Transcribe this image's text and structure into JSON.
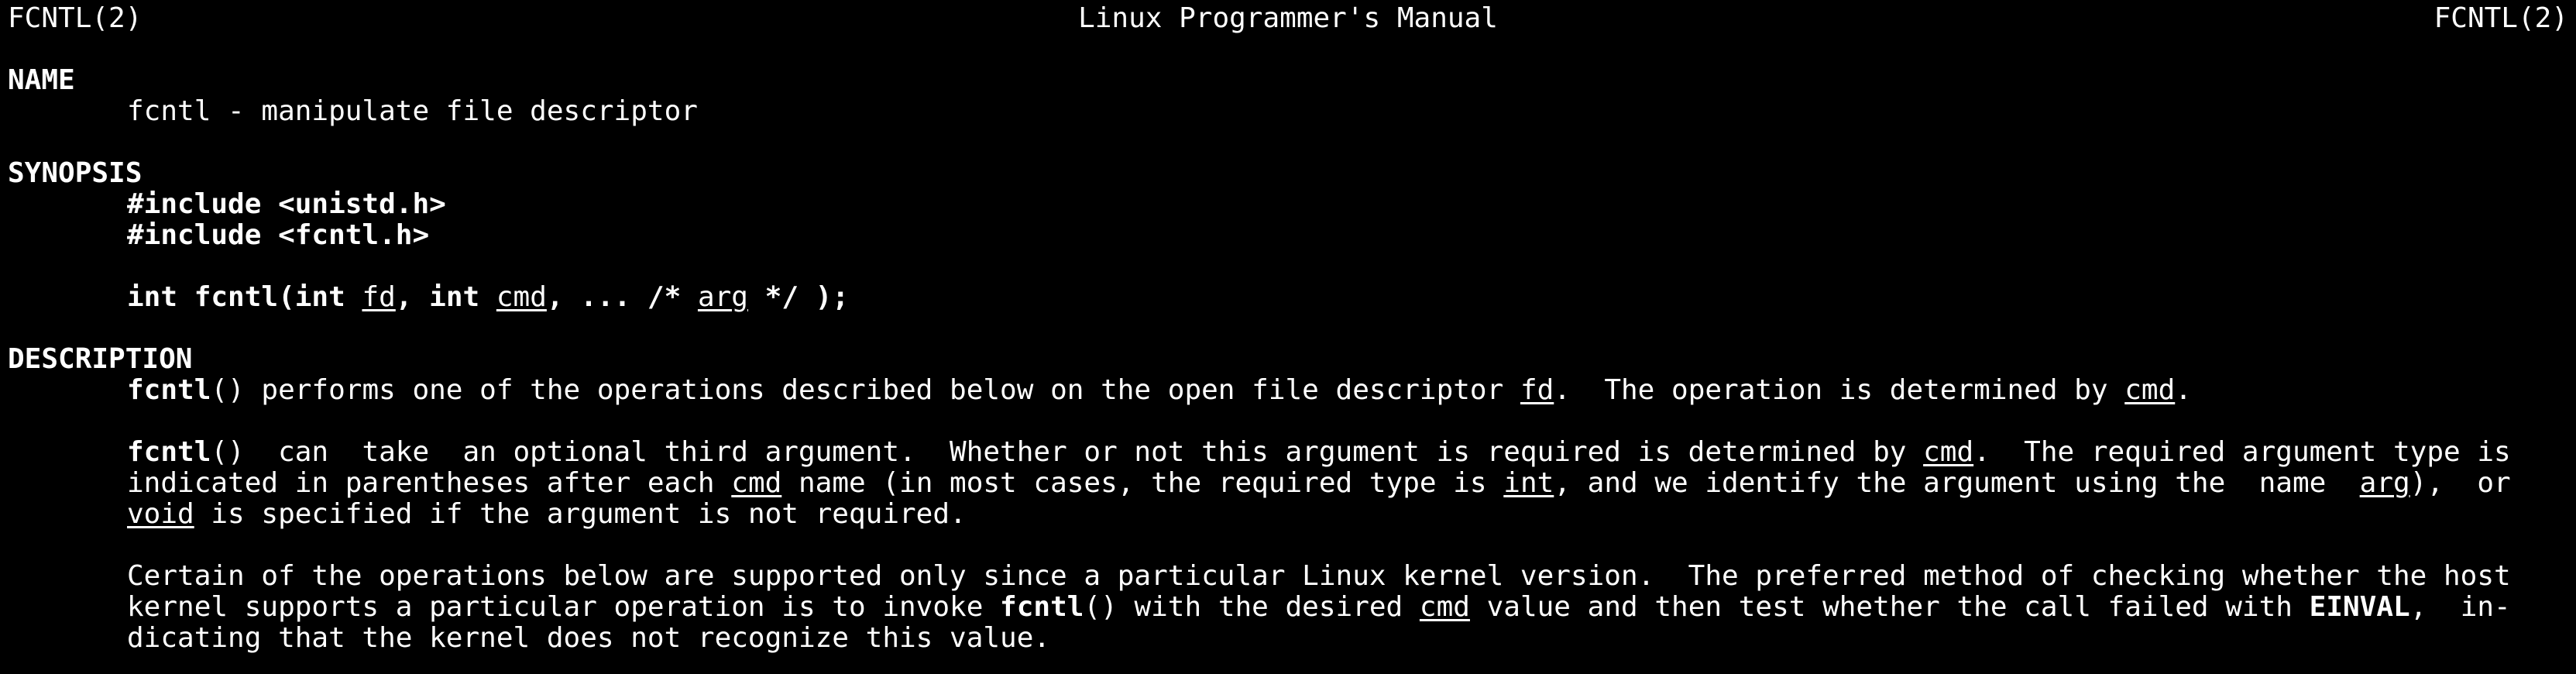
{
  "header": {
    "left": "FCNTL(2)",
    "center": "Linux Programmer's Manual",
    "right": "FCNTL(2)"
  },
  "sections": {
    "name": {
      "title": "NAME",
      "text": "fcntl - manipulate file descriptor"
    },
    "synopsis": {
      "title": "SYNOPSIS",
      "include1": "#include <unistd.h>",
      "include2": "#include <fcntl.h>",
      "proto": {
        "p1": "int fcntl(int ",
        "fd": "fd",
        "p2": ", int ",
        "cmd": "cmd",
        "p3": ", ... /* ",
        "arg": "arg",
        "p4": " */ );"
      }
    },
    "description": {
      "title": "DESCRIPTION",
      "para1": {
        "fn": "fcntl",
        "t1": "() performs one of the operations described below on the open file descriptor ",
        "fd": "fd",
        "t2": ".  The operation is determined by ",
        "cmd": "cmd",
        "t3": "."
      },
      "para2": {
        "l1_fn": "fcntl",
        "l1_t1": "()  can  take  an optional third argument.  Whether or not this argument is required is determined by ",
        "l1_cmd": "cmd",
        "l1_t2": ".  The required argument type is",
        "l2_t1": "indicated in parentheses after each ",
        "l2_cmd": "cmd",
        "l2_t2": " name (in most cases, the required type is ",
        "l2_int": "int",
        "l2_t3": ", and we identify the argument using the  name  ",
        "l2_arg": "arg",
        "l2_t4": "),  or",
        "l3_void": "void",
        "l3_t1": " is specified if the argument is not required."
      },
      "para3": {
        "l1": "Certain of the operations below are supported only since a particular Linux kernel version.  The preferred method of checking whether the host",
        "l2_t1": "kernel supports a particular operation is to invoke ",
        "l2_fn": "fcntl",
        "l2_t2": "() with the desired ",
        "l2_cmd": "cmd",
        "l2_t3": " value and then test whether the call failed with ",
        "l2_einval": "EINVAL",
        "l2_t4": ",  in-",
        "l3": "dicating that the kernel does not recognize this value."
      }
    }
  }
}
